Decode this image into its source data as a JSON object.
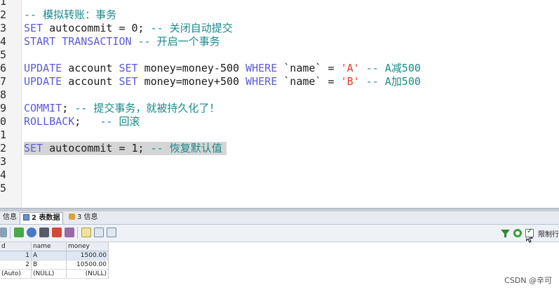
{
  "editor": {
    "line_numbers": [
      "1",
      "2",
      "3",
      "4",
      "5",
      "6",
      "7",
      "8",
      "9",
      "0",
      "1",
      "2",
      "3",
      "4",
      "5"
    ],
    "lines": [
      {
        "parts": []
      },
      {
        "parts": [
          {
            "t": "-- 模拟转账：事务",
            "c": "cm"
          }
        ]
      },
      {
        "parts": [
          {
            "t": "SET",
            "c": "kw"
          },
          {
            "t": " autocommit = 0; ",
            "c": "plain"
          },
          {
            "t": "-- 关闭自动提交",
            "c": "cm"
          }
        ]
      },
      {
        "parts": [
          {
            "t": "START TRANSACTION",
            "c": "kw"
          },
          {
            "t": " ",
            "c": "plain"
          },
          {
            "t": "-- 开启一个事务",
            "c": "cm"
          }
        ]
      },
      {
        "parts": []
      },
      {
        "parts": [
          {
            "t": "UPDATE",
            "c": "kw"
          },
          {
            "t": " account ",
            "c": "plain"
          },
          {
            "t": "SET",
            "c": "kw"
          },
          {
            "t": " money=money-500 ",
            "c": "plain"
          },
          {
            "t": "WHERE",
            "c": "kw"
          },
          {
            "t": " `name` = ",
            "c": "plain"
          },
          {
            "t": "'A'",
            "c": "str"
          },
          {
            "t": " ",
            "c": "plain"
          },
          {
            "t": "-- A减500",
            "c": "cm"
          }
        ]
      },
      {
        "parts": [
          {
            "t": "UPDATE",
            "c": "kw"
          },
          {
            "t": " account ",
            "c": "plain"
          },
          {
            "t": "SET",
            "c": "kw"
          },
          {
            "t": " money=money+500 ",
            "c": "plain"
          },
          {
            "t": "WHERE",
            "c": "kw"
          },
          {
            "t": " `name` = ",
            "c": "plain"
          },
          {
            "t": "'B'",
            "c": "str"
          },
          {
            "t": " ",
            "c": "plain"
          },
          {
            "t": "-- A加500",
            "c": "cm"
          }
        ]
      },
      {
        "parts": []
      },
      {
        "parts": [
          {
            "t": "COMMIT",
            "c": "kw"
          },
          {
            "t": "; ",
            "c": "plain"
          },
          {
            "t": "-- 提交事务，就被持久化了！",
            "c": "cm"
          }
        ]
      },
      {
        "parts": [
          {
            "t": "ROLLBACK",
            "c": "kw"
          },
          {
            "t": ";   ",
            "c": "plain"
          },
          {
            "t": "-- 回滚",
            "c": "cm"
          }
        ]
      },
      {
        "parts": []
      },
      {
        "parts": [
          {
            "t": "SET",
            "c": "kw"
          },
          {
            "t": " autocommit = 1; ",
            "c": "plain"
          },
          {
            "t": "-- 恢复默认值",
            "c": "cm"
          }
        ],
        "selected": true
      },
      {
        "parts": []
      },
      {
        "parts": []
      },
      {
        "parts": []
      }
    ]
  },
  "result_tabs": [
    {
      "label": "信息",
      "icon": "info-icon",
      "active": false
    },
    {
      "label": "2 表数据",
      "icon": "table-data-icon",
      "active": true
    },
    {
      "label": "3 信息",
      "icon": "info-icon",
      "active": false
    }
  ],
  "toolbar_icons": [
    "grid-menu-icon",
    "add-row-icon",
    "refresh-icon",
    "save-icon",
    "delete-icon",
    "copy-icon",
    "view-grid-icon",
    "view-form-icon",
    "view-text-icon"
  ],
  "right_tools": {
    "filter_icon": "filter-icon",
    "refresh_icon": "refresh-icon",
    "limit_label": "限制行",
    "limit_checked": true
  },
  "table": {
    "columns": [
      "d",
      "name",
      "money"
    ],
    "rows": [
      {
        "id": "1",
        "name": "A",
        "money": "1500.00",
        "selected": true
      },
      {
        "id": "2",
        "name": "B",
        "money": "10500.00",
        "selected": false
      },
      {
        "id": "(Auto)",
        "name": "(NULL)",
        "money": "(NULL)",
        "selected": false
      }
    ]
  },
  "watermark": "CSDN @辛可",
  "colors": {
    "keyword": "#5b5bd6",
    "comment": "#1a8a8a",
    "string": "#e03d27"
  }
}
